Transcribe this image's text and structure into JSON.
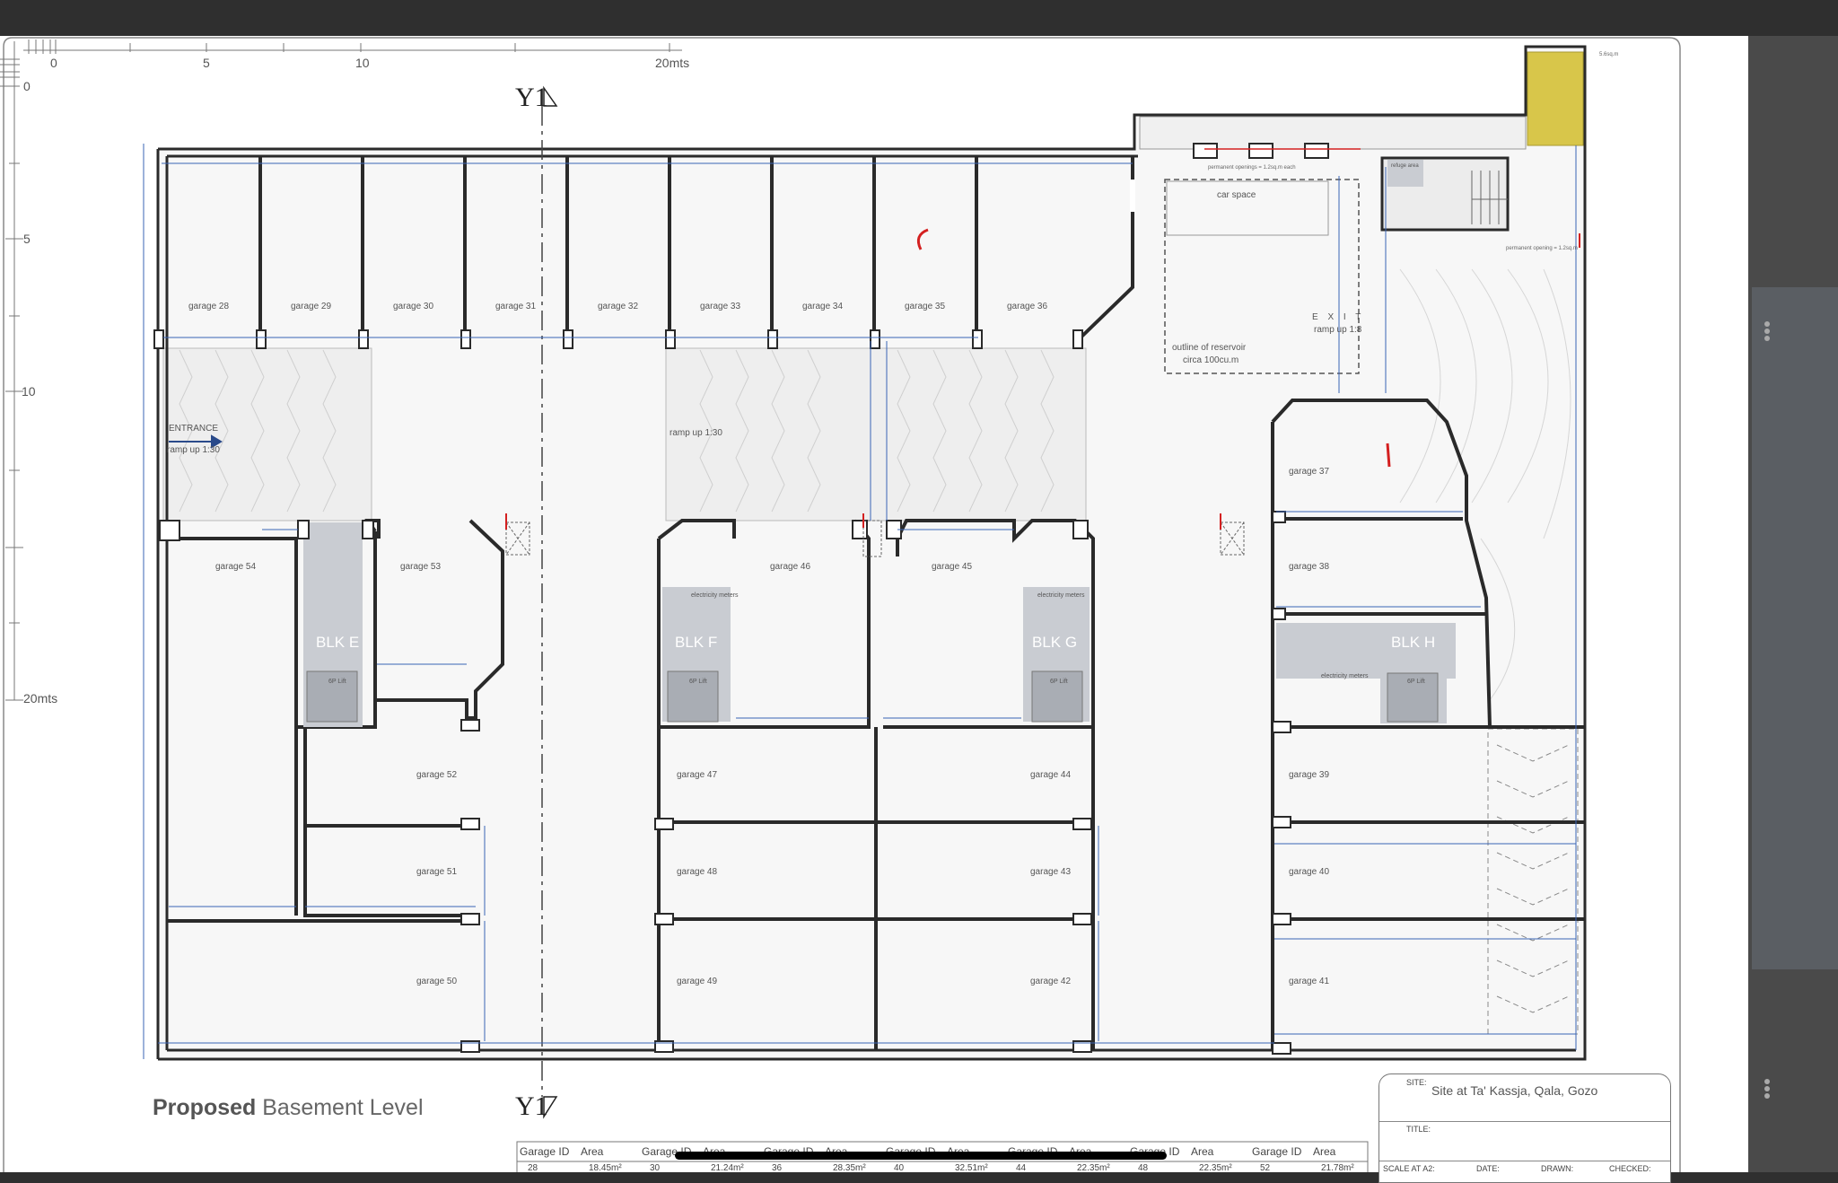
{
  "drawing": {
    "title_bold": "Proposed",
    "title_rest": " Basement Level",
    "section_marker": "Y1",
    "scale_labels": [
      "0",
      "5",
      "10",
      "20mts"
    ],
    "v_scale_labels": [
      "0",
      "5",
      "10",
      "20mts"
    ],
    "garages": [
      {
        "id": "g28",
        "label": "garage 28"
      },
      {
        "id": "g29",
        "label": "garage 29"
      },
      {
        "id": "g30",
        "label": "garage 30"
      },
      {
        "id": "g31",
        "label": "garage 31"
      },
      {
        "id": "g32",
        "label": "garage 32"
      },
      {
        "id": "g33",
        "label": "garage 33"
      },
      {
        "id": "g34",
        "label": "garage 34"
      },
      {
        "id": "g35",
        "label": "garage 35"
      },
      {
        "id": "g36",
        "label": "garage 36"
      },
      {
        "id": "g37",
        "label": "garage 37"
      },
      {
        "id": "g38",
        "label": "garage 38"
      },
      {
        "id": "g39",
        "label": "garage 39"
      },
      {
        "id": "g40",
        "label": "garage 40"
      },
      {
        "id": "g41",
        "label": "garage 41"
      },
      {
        "id": "g42",
        "label": "garage 42"
      },
      {
        "id": "g43",
        "label": "garage 43"
      },
      {
        "id": "g44",
        "label": "garage 44"
      },
      {
        "id": "g45",
        "label": "garage 45"
      },
      {
        "id": "g46",
        "label": "garage 46"
      },
      {
        "id": "g47",
        "label": "garage 47"
      },
      {
        "id": "g48",
        "label": "garage 48"
      },
      {
        "id": "g49",
        "label": "garage 49"
      },
      {
        "id": "g50",
        "label": "garage 50"
      },
      {
        "id": "g51",
        "label": "garage 51"
      },
      {
        "id": "g52",
        "label": "garage 52"
      },
      {
        "id": "g53",
        "label": "garage 53"
      },
      {
        "id": "g54",
        "label": "garage 54"
      }
    ],
    "blocks": [
      "BLK E",
      "BLK F",
      "BLK G",
      "BLK H"
    ],
    "lift_label": "6P Lift",
    "meters_label": "electricity meters",
    "entrance_label": "ENTRANCE",
    "entrance_ramp": "ramp up 1:30",
    "central_ramp": "ramp up 1:30",
    "exit_label": "E X I T",
    "exit_ramp": "ramp up 1:8",
    "car_space": "car space",
    "reservoir_line1": "outline of reservoir",
    "reservoir_line2": "circa 100cu.m",
    "refuge_area": "refuge area",
    "perm_openings_top": "permanent openings = 1.2sq.m each",
    "perm_opening_right": "permanent opening = 1.2sq.m",
    "sqm_note": "5.6sq.m"
  },
  "title_block": {
    "site_label": "SITE:",
    "site_value": "Site at Ta' Kassja, Qala, Gozo",
    "title_label": "TITLE:",
    "scale_label": "SCALE AT A2:",
    "date_label": "DATE:",
    "drawn_label": "DRAWN:",
    "checked_label": "CHECKED:"
  },
  "area_table": {
    "headers": [
      "Garage ID",
      "Area",
      "Garage ID",
      "Area",
      "Garage ID",
      "Area",
      "Garage ID",
      "Area",
      "Garage ID",
      "Area",
      "Garage ID",
      "Area",
      "Garage ID",
      "Area"
    ],
    "row1": [
      "28",
      "18.45m²",
      "30",
      "21.24m²",
      "36",
      "28.35m²",
      "40",
      "32.51m²",
      "44",
      "22.35m²",
      "48",
      "22.35m²",
      "52",
      "21.78m²"
    ]
  },
  "colors": {
    "background": "#2f2f2f",
    "sheet": "#ffffff",
    "wall": "#2a2a2a",
    "core_fill": "#c9ccd2",
    "dimension": "#3a64b5",
    "markup_red": "#d42020",
    "soakaway_yellow": "#d8c64a"
  }
}
